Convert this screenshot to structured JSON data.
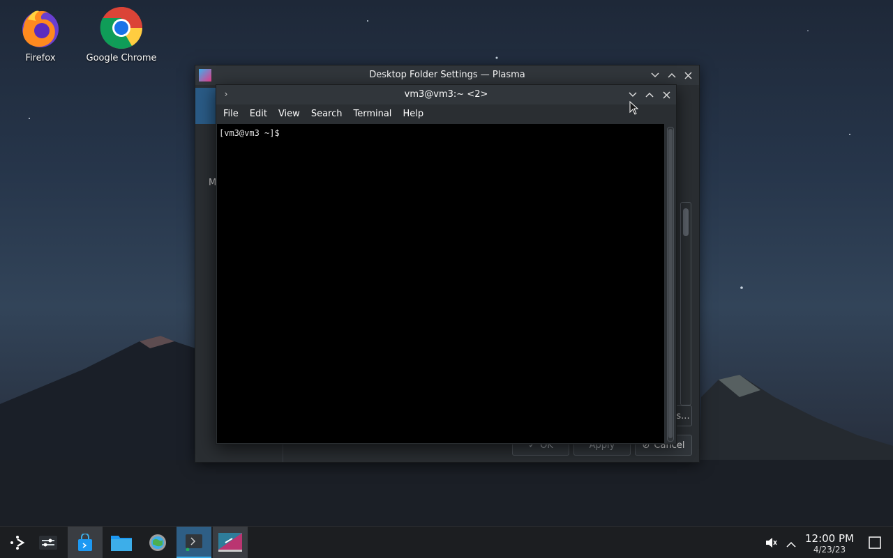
{
  "desktop": {
    "icons": [
      {
        "label": "Firefox",
        "icon": "firefox-icon"
      },
      {
        "label": "Google Chrome",
        "icon": "chrome-icon"
      }
    ]
  },
  "back_window": {
    "title": "Desktop Folder Settings — Plasma",
    "sidebar_fragment": "M",
    "ok_label": "OK",
    "apply_label": "Apply",
    "cancel_label": "Cancel",
    "partial_button": "s..."
  },
  "terminal": {
    "title": "vm3@vm3:~ <2>",
    "menu": [
      "File",
      "Edit",
      "View",
      "Search",
      "Terminal",
      "Help"
    ],
    "prompt": "[vm3@vm3 ~]$"
  },
  "taskbar": {
    "items": [
      "application-launcher-icon",
      "activities-icon",
      "discover-store-icon",
      "file-manager-icon",
      "system-settings-icon",
      "konsole-icon",
      "system-settings-window-icon"
    ],
    "time": "12:00 PM",
    "date": "4/23/23"
  },
  "colors": {
    "accent": "#3daee9",
    "window_bg": "#2a2e32",
    "titlebar": "#31363b",
    "terminal_bg": "#000000"
  }
}
